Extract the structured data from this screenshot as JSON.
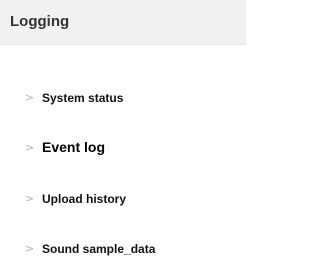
{
  "panel": {
    "title": "Logging",
    "items": [
      {
        "label": "System status",
        "icon": "chevron-right-icon",
        "active": false
      },
      {
        "label": "Event log",
        "icon": "chevron-right-icon",
        "active": true
      },
      {
        "label": "Upload history",
        "icon": "chevron-right-icon",
        "active": false
      },
      {
        "label": "Sound sample_data",
        "icon": "chevron-right-icon",
        "active": false
      }
    ]
  },
  "glyphs": {
    "chevron": ">"
  }
}
